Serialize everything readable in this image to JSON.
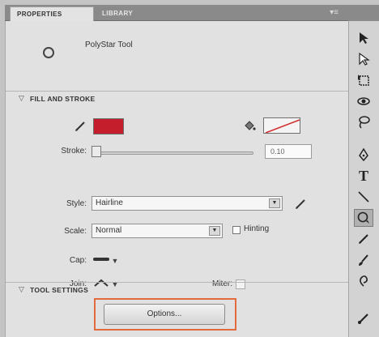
{
  "tabs": [
    {
      "label": "PROPERTIES",
      "active": true
    },
    {
      "label": "LIBRARY",
      "active": false
    }
  ],
  "panel_menu_icon": "panel-menu-icon",
  "tool": {
    "name": "PolyStar Tool",
    "icon": "polystar-circle-icon"
  },
  "sections": {
    "fill_stroke": "FILL AND STROKE",
    "tool_settings": "TOOL SETTINGS"
  },
  "colors": {
    "fill": "#c41e2c",
    "stroke": "none",
    "highlight": "#e26a3c"
  },
  "fields": {
    "stroke_label": "Stroke:",
    "stroke_value": "0.10",
    "style_label": "Style:",
    "style_value": "Hairline",
    "scale_label": "Scale:",
    "scale_value": "Normal",
    "hinting_label": "Hinting",
    "cap_label": "Cap:",
    "join_label": "Join:",
    "miter_label": "Miter:"
  },
  "buttons": {
    "options": "Options..."
  },
  "toolbox_icons": [
    "arrow-select-icon",
    "subselect-icon",
    "free-transform-icon",
    "3d-rotation-icon",
    "lasso-icon",
    "pen-icon",
    "text-icon",
    "line-icon",
    "polystar-icon",
    "pencil-icon",
    "brush-icon",
    "deco-icon",
    "bone-icon"
  ]
}
